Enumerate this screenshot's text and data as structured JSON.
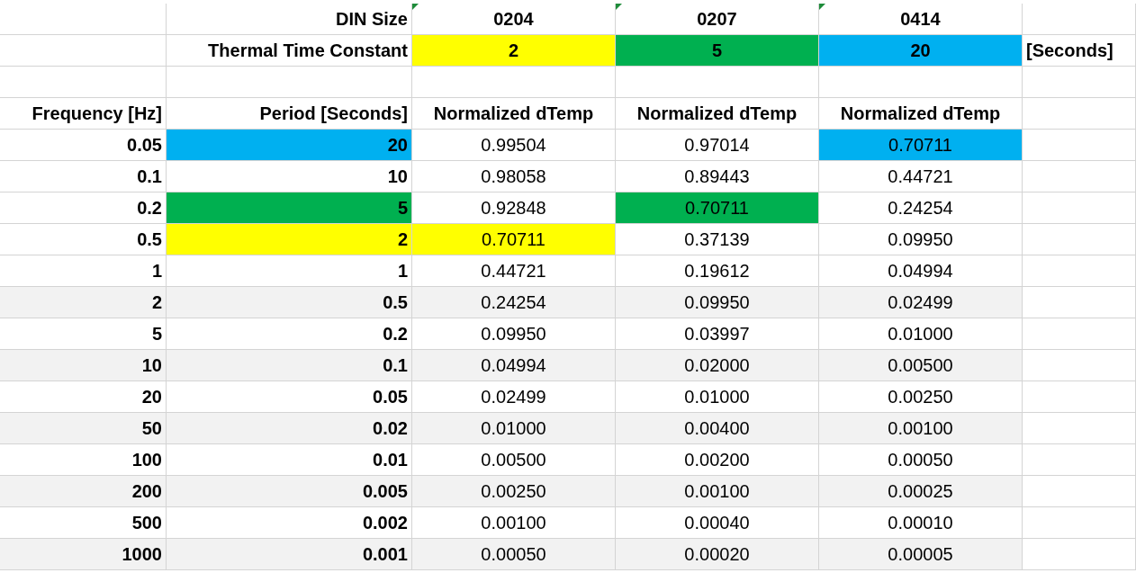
{
  "header_rows": [
    {
      "label": "DIN Size",
      "cells": [
        {
          "text": "0204",
          "error_flag": true
        },
        {
          "text": "0207",
          "error_flag": true
        },
        {
          "text": "0414",
          "error_flag": true
        }
      ]
    },
    {
      "label": "Thermal Time Constant",
      "cells": [
        {
          "text": "2",
          "error_flag": false,
          "color": "#ffff00"
        },
        {
          "text": "5",
          "error_flag": false,
          "color": "#00b050"
        },
        {
          "text": "20",
          "error_flag": false,
          "color": "#00b0f0"
        }
      ],
      "unit": "[Seconds]"
    }
  ],
  "column_headers": [
    "Frequency [Hz]",
    "Period [Seconds]",
    "Normalized dTemp",
    "Normalized dTemp",
    "Normalized dTemp"
  ],
  "rows": [
    {
      "shaded": false,
      "frequency": "0.05",
      "period": {
        "text": "20",
        "color": "#00b0f0"
      },
      "values": [
        {
          "text": "0.99504"
        },
        {
          "text": "0.97014"
        },
        {
          "text": "0.70711",
          "color": "#00b0f0"
        }
      ]
    },
    {
      "shaded": false,
      "frequency": "0.1",
      "period": {
        "text": "10"
      },
      "values": [
        {
          "text": "0.98058"
        },
        {
          "text": "0.89443"
        },
        {
          "text": "0.44721"
        }
      ]
    },
    {
      "shaded": false,
      "frequency": "0.2",
      "period": {
        "text": "5",
        "color": "#00b050"
      },
      "values": [
        {
          "text": "0.92848"
        },
        {
          "text": "0.70711",
          "color": "#00b050"
        },
        {
          "text": "0.24254"
        }
      ]
    },
    {
      "shaded": false,
      "frequency": "0.5",
      "period": {
        "text": "2",
        "color": "#ffff00"
      },
      "values": [
        {
          "text": "0.70711",
          "color": "#ffff00"
        },
        {
          "text": "0.37139"
        },
        {
          "text": "0.09950"
        }
      ]
    },
    {
      "shaded": false,
      "frequency": "1",
      "period": {
        "text": "1"
      },
      "values": [
        {
          "text": "0.44721"
        },
        {
          "text": "0.19612"
        },
        {
          "text": "0.04994"
        }
      ]
    },
    {
      "shaded": true,
      "frequency": "2",
      "period": {
        "text": "0.5"
      },
      "values": [
        {
          "text": "0.24254"
        },
        {
          "text": "0.09950"
        },
        {
          "text": "0.02499"
        }
      ]
    },
    {
      "shaded": false,
      "frequency": "5",
      "period": {
        "text": "0.2"
      },
      "values": [
        {
          "text": "0.09950"
        },
        {
          "text": "0.03997"
        },
        {
          "text": "0.01000"
        }
      ]
    },
    {
      "shaded": true,
      "frequency": "10",
      "period": {
        "text": "0.1"
      },
      "values": [
        {
          "text": "0.04994"
        },
        {
          "text": "0.02000"
        },
        {
          "text": "0.00500"
        }
      ]
    },
    {
      "shaded": false,
      "frequency": "20",
      "period": {
        "text": "0.05"
      },
      "values": [
        {
          "text": "0.02499"
        },
        {
          "text": "0.01000"
        },
        {
          "text": "0.00250"
        }
      ]
    },
    {
      "shaded": true,
      "frequency": "50",
      "period": {
        "text": "0.02"
      },
      "values": [
        {
          "text": "0.01000"
        },
        {
          "text": "0.00400"
        },
        {
          "text": "0.00100"
        }
      ]
    },
    {
      "shaded": false,
      "frequency": "100",
      "period": {
        "text": "0.01"
      },
      "values": [
        {
          "text": "0.00500"
        },
        {
          "text": "0.00200"
        },
        {
          "text": "0.00050"
        }
      ]
    },
    {
      "shaded": true,
      "frequency": "200",
      "period": {
        "text": "0.005"
      },
      "values": [
        {
          "text": "0.00250"
        },
        {
          "text": "0.00100"
        },
        {
          "text": "0.00025"
        }
      ]
    },
    {
      "shaded": false,
      "frequency": "500",
      "period": {
        "text": "0.002"
      },
      "values": [
        {
          "text": "0.00100"
        },
        {
          "text": "0.00040"
        },
        {
          "text": "0.00010"
        }
      ]
    },
    {
      "shaded": true,
      "frequency": "1000",
      "period": {
        "text": "0.001"
      },
      "values": [
        {
          "text": "0.00050"
        },
        {
          "text": "0.00020"
        },
        {
          "text": "0.00005"
        }
      ]
    }
  ]
}
